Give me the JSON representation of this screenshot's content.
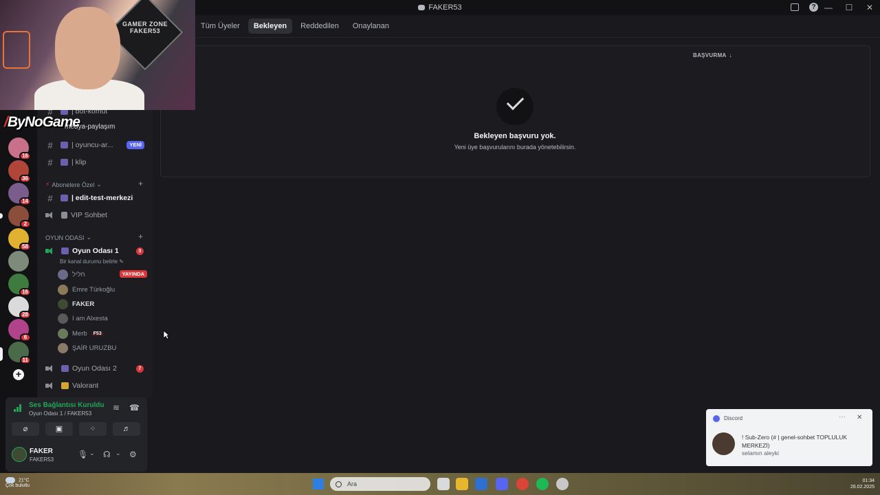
{
  "window": {
    "title": "FAKER53",
    "minimize": "—",
    "maximize": "☐",
    "close": "✕",
    "help": "?"
  },
  "overlay": {
    "logo_main": "ByNoGame",
    "logo_prefix": "/",
    "channel_partial": "medya-paylaşım",
    "sign_text": "GAMER ZONE FAKER53"
  },
  "rail": {
    "servers": [
      {
        "badge": "16",
        "color": "#c9718a"
      },
      {
        "badge": "36",
        "color": "#b0453a"
      },
      {
        "badge": "14",
        "color": "#7a5d8c"
      },
      {
        "badge": "2",
        "color": "#8a4e3a"
      },
      {
        "badge": "58",
        "color": "#e1b132"
      },
      {
        "badge": "",
        "color": "#7e8a7a"
      },
      {
        "badge": "16",
        "color": "#3f7a3f"
      },
      {
        "badge": "28",
        "color": "#dadada"
      },
      {
        "badge": "6",
        "color": "#b0438a"
      },
      {
        "badge": "11",
        "color": "#4a6a4a"
      }
    ],
    "add_label": "+"
  },
  "channels": {
    "items": [
      {
        "label": "| bot-komut",
        "type": "text"
      },
      {
        "label": "| oyuncu-ar...",
        "type": "text",
        "badge": "YENİ"
      },
      {
        "label": "| klip",
        "type": "text"
      },
      {
        "label": "| edit-test-merkezi",
        "type": "text",
        "active": true
      },
      {
        "label": "VIP Sohbet",
        "type": "voice"
      },
      {
        "label": "Oyun Odası 1",
        "type": "voice",
        "active": true,
        "count": "3"
      },
      {
        "label": "Oyun Odası 2",
        "type": "voice",
        "count": "7"
      },
      {
        "label": "Valorant",
        "type": "voice"
      }
    ],
    "categories": [
      "Abonelere Özel",
      "OYUN ODASI"
    ],
    "status_hint": "Bir kanal durumu belirle",
    "members": [
      {
        "name": "חליל",
        "live": "YAYINDA",
        "color": "#6a6a8a"
      },
      {
        "name": "Emre Türkoğlu",
        "color": "#8a7a5a"
      },
      {
        "name": "FAKER",
        "bold": true,
        "color": "#3f4a32"
      },
      {
        "name": "I am Alxesta",
        "color": "#5a5a5a"
      },
      {
        "name": "Merb",
        "tag": "F53",
        "color": "#6a7a5a"
      },
      {
        "name": "ŞAİR URUZBU",
        "color": "#8a7a6a"
      }
    ]
  },
  "voice": {
    "status": "Ses Bağlantısı Kuruldu",
    "location": "Oyun Odası 1 / FAKER53",
    "user_name": "FAKER",
    "user_status": "FAKER53"
  },
  "tabs": [
    "Tüm Üyeler",
    "Bekleyen",
    "Reddedilen",
    "Onaylanan"
  ],
  "main": {
    "sort_label": "BAŞVURMA",
    "empty_title": "Bekleyen başvuru yok.",
    "empty_subtitle": "Yeni üye başvurularını burada yönetebilirsin."
  },
  "toast": {
    "app": "Discord",
    "line1": "! Sub-Zero (# | genel-sohbet TOPLULUK MERKEZİ)",
    "line2": "selamın aleyki"
  },
  "taskbar": {
    "weather_line1": "21°C",
    "weather_line2": "Çok bulutlu",
    "search_placeholder": "Ara",
    "clock_time": "01:34",
    "clock_date": "26.02.2025"
  },
  "colors": {
    "accent": "#5865f2",
    "online": "#23a55a",
    "danger": "#da373c"
  }
}
